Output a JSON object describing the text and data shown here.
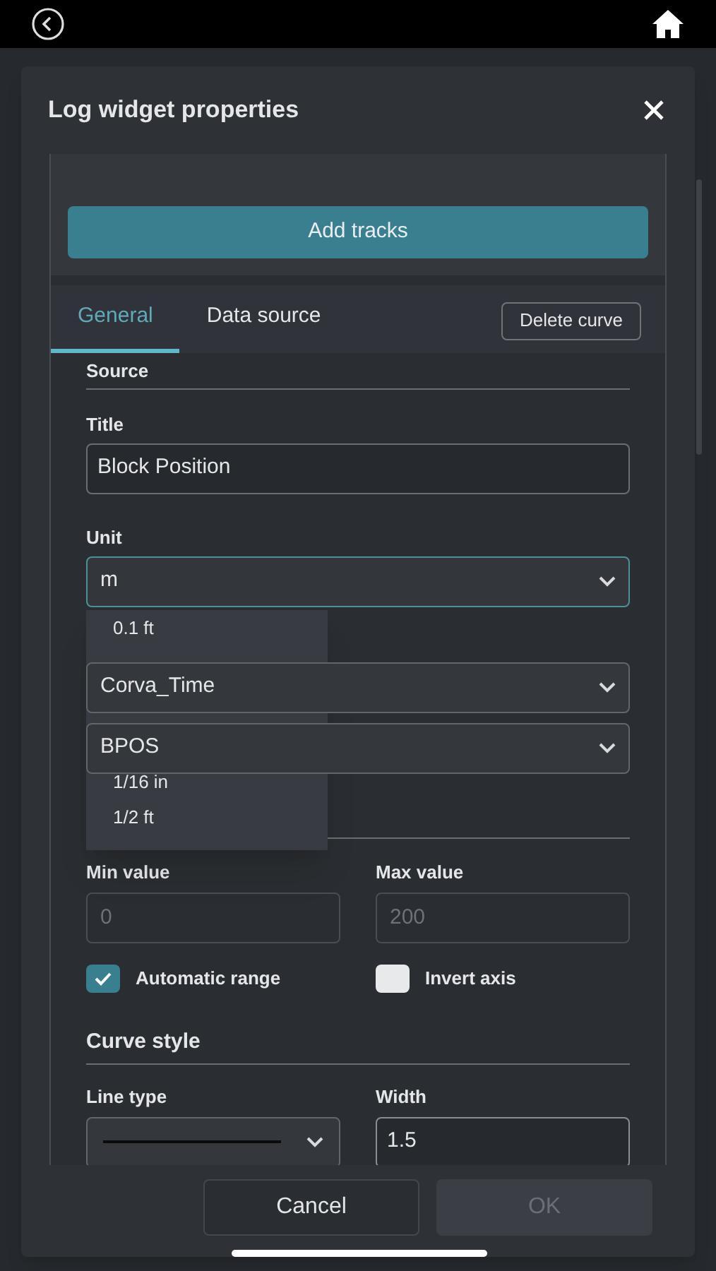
{
  "dialog": {
    "title": "Log widget properties"
  },
  "add_tracks_button": "Add tracks",
  "tabs": [
    {
      "label": "General",
      "selected": true
    },
    {
      "label": "Data source",
      "selected": false
    }
  ],
  "delete_curve_button": "Delete curve",
  "source_section": {
    "heading": "Source",
    "title_label": "Title",
    "title_value": "Block Position",
    "unit_label": "Unit",
    "unit_value": "m",
    "unit_menu": [
      "0.1 ft",
      "1/16 in",
      "1/2 ft"
    ],
    "selects": [
      "Corva_Time",
      "BPOS"
    ]
  },
  "range": {
    "min_label": "Min value",
    "min_placeholder": "0",
    "max_label": "Max value",
    "max_placeholder": "200",
    "checkboxes": [
      {
        "label": "Automatic range",
        "checked": true
      },
      {
        "label": "Invert axis",
        "checked": false
      }
    ]
  },
  "curve_style": {
    "heading": "Curve style",
    "line_type_label": "Line type",
    "width_label": "Width",
    "width_value": "1.5"
  },
  "footer": {
    "cancel": "Cancel",
    "ok": "OK",
    "ok_disabled": true
  }
}
